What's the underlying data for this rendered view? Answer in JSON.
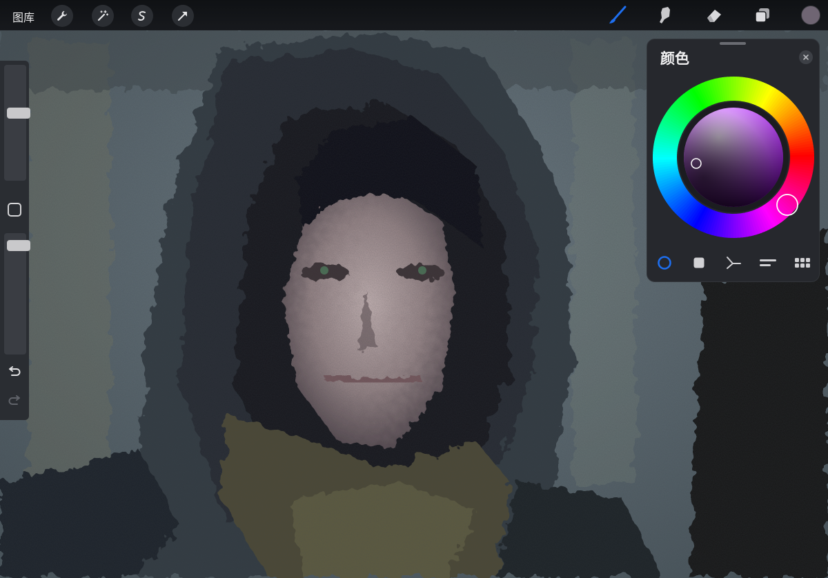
{
  "topbar": {
    "gallery_label": "图库",
    "tools": [
      {
        "icon": "wrench-icon"
      },
      {
        "icon": "magic-wand-icon"
      },
      {
        "icon": "selection-icon"
      },
      {
        "icon": "transform-arrow-icon"
      }
    ],
    "right_tools": [
      {
        "icon": "brush-icon",
        "active": true
      },
      {
        "icon": "smudge-icon"
      },
      {
        "icon": "eraser-icon"
      },
      {
        "icon": "layers-icon"
      }
    ],
    "current_color": "#6f6573"
  },
  "sidebar": {
    "brush_size_level": 0.41,
    "opacity_level": 0.06
  },
  "color_panel": {
    "title": "颜色",
    "selected_hue_color": "#b21bff",
    "tabs": [
      {
        "icon": "disc-icon",
        "active": true
      },
      {
        "icon": "classic-square-icon"
      },
      {
        "icon": "harmony-icon"
      },
      {
        "icon": "value-sliders-icon"
      },
      {
        "icon": "palettes-grid-icon"
      }
    ]
  },
  "colors": {
    "accent": "#1e6ff0",
    "panel_bg": "#26282d",
    "toolbar_bg": "#15171a"
  }
}
